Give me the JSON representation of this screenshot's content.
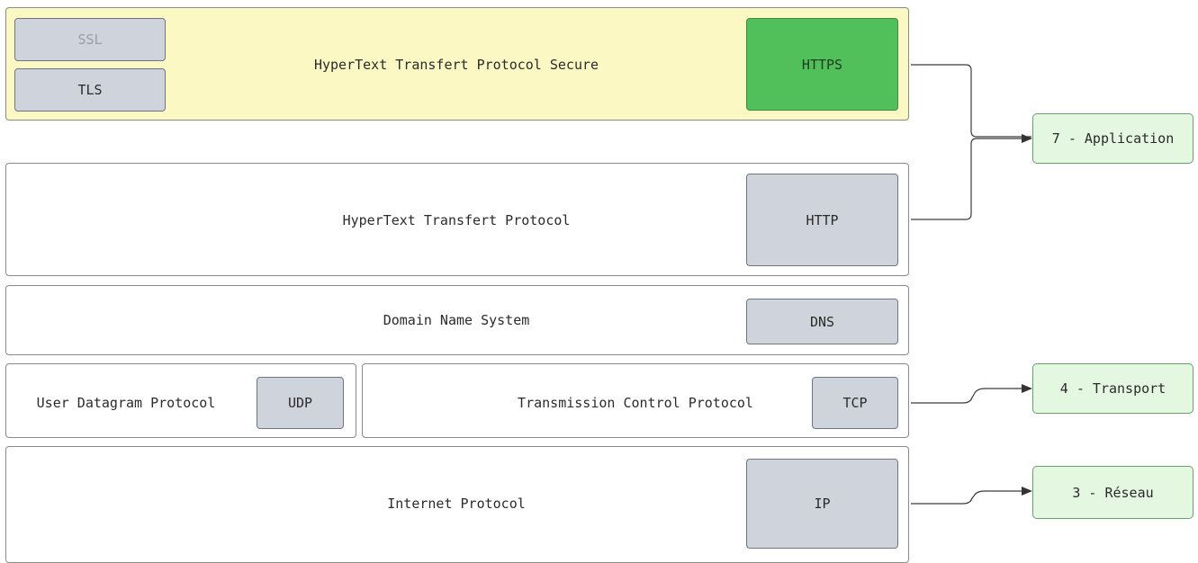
{
  "layers": {
    "https": {
      "label": "HyperText Transfert Protocol Secure",
      "tag": "HTTPS",
      "ssl": "SSL",
      "tls": "TLS"
    },
    "http": {
      "label": "HyperText Transfert Protocol",
      "tag": "HTTP"
    },
    "dns": {
      "label": "Domain Name System",
      "tag": "DNS"
    },
    "udp": {
      "label": "User Datagram Protocol",
      "tag": "UDP"
    },
    "tcp": {
      "label": "Transmission Control Protocol",
      "tag": "TCP"
    },
    "ip": {
      "label": "Internet Protocol",
      "tag": "IP"
    }
  },
  "osi_layers": {
    "application": "7 - Application",
    "transport": "4 - Transport",
    "reseau": "3 - Réseau"
  },
  "colors": {
    "secure_background": "#fbf8c4",
    "https_tag": "#52c05a",
    "protocol_tag": "#cfd3db",
    "osi_box": "#e4f7e1"
  }
}
